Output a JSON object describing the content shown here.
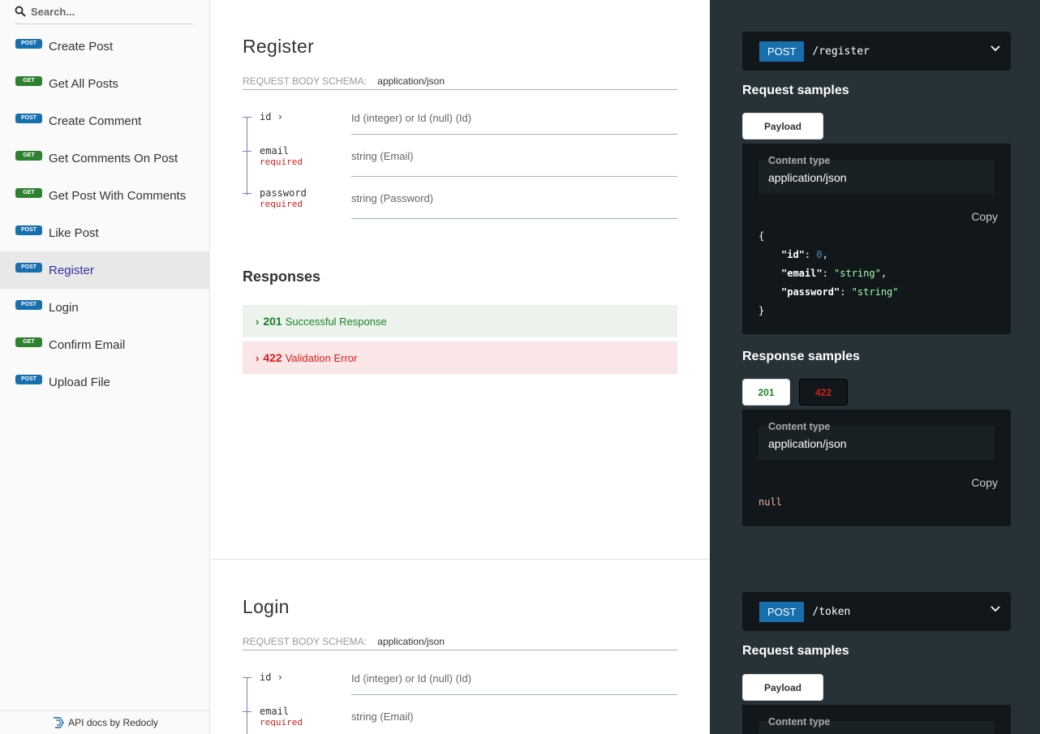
{
  "sidebar": {
    "search_placeholder": "Search...",
    "items": [
      {
        "method": "POST",
        "label": "Create Post"
      },
      {
        "method": "GET",
        "label": "Get All Posts"
      },
      {
        "method": "POST",
        "label": "Create Comment"
      },
      {
        "method": "GET",
        "label": "Get Comments On Post"
      },
      {
        "method": "GET",
        "label": "Get Post With Comments"
      },
      {
        "method": "POST",
        "label": "Like Post"
      },
      {
        "method": "POST",
        "label": "Register"
      },
      {
        "method": "POST",
        "label": "Login"
      },
      {
        "method": "GET",
        "label": "Confirm Email"
      },
      {
        "method": "POST",
        "label": "Upload File"
      }
    ],
    "active_item": "Register",
    "footer": "API docs by Redocly"
  },
  "register": {
    "title": "Register",
    "schema_label": "REQUEST BODY SCHEMA:",
    "schema_type": "application/json",
    "fields": [
      {
        "name": "id",
        "type": "Id (integer) or Id (null) (Id)"
      },
      {
        "name": "email",
        "required": "required",
        "type": "string (Email)"
      },
      {
        "name": "password",
        "required": "required",
        "type": "string (Password)"
      }
    ],
    "responses_title": "Responses",
    "responses": [
      {
        "code": "201",
        "text": "Successful Response"
      },
      {
        "code": "422",
        "text": "Validation Error"
      }
    ],
    "endpoint": {
      "method": "POST",
      "path": "/register"
    },
    "request_samples": "Request samples",
    "payload_tab": "Payload",
    "content_type_label": "Content type",
    "content_type_value": "application/json",
    "copy": "Copy",
    "json": {
      "open": "{",
      "close": "}",
      "id_key": "\"id\"",
      "id_val": "0",
      "email_key": "\"email\"",
      "email_val": "\"string\"",
      "password_key": "\"password\"",
      "password_val": "\"string\""
    },
    "response_samples": "Response samples",
    "resp_tabs": [
      "201",
      "422"
    ],
    "resp_null": "null"
  },
  "login": {
    "title": "Login",
    "schema_label": "REQUEST BODY SCHEMA:",
    "schema_type": "application/json",
    "fields": [
      {
        "name": "id",
        "type": "Id (integer) or Id (null) (Id)"
      },
      {
        "name": "email",
        "required": "required",
        "type": "string (Email)"
      }
    ],
    "endpoint": {
      "method": "POST",
      "path": "/token"
    },
    "request_samples": "Request samples",
    "payload_tab": "Payload",
    "content_type_label": "Content type"
  },
  "colors": {
    "post": "#186fae",
    "get": "#2f8132",
    "success": "#1d8127",
    "error": "#d41f1c",
    "right_panel": "#263238"
  }
}
